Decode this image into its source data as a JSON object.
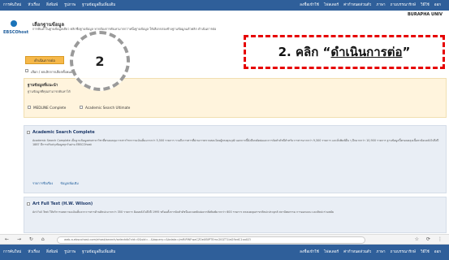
{
  "topbar": {
    "left": [
      "การค้นใหม่",
      "หัวเรื่อง",
      "สิ่งพิมพ์",
      "รูปภาพ",
      "ฐานข้อมูลอื่นเพิ่มเติม"
    ],
    "right": [
      "ลงชื่อเข้าใช้",
      "โฟลเดอร์",
      "ค่ากำหนดส่วนตัว",
      "ภาษา",
      "ถามบรรณารักษ์",
      "วิธีใช้",
      "ออก"
    ]
  },
  "brand": "BURAPHA UNIV",
  "logo_text": "EBSCOhost",
  "page": {
    "title": "เลือกฐานข้อมูล",
    "desc": "การค้นหาในฐานข้อมูลเดียว คลิกชื่อฐานข้อมูล หากต้องการค้นหามากกว่าหนึ่งฐานข้อมูล ให้เลือกกล่องข้างฐานข้อมูลแล้วคลิก ดำเนินการต่อ"
  },
  "continue_label": "ดำเนินการต่อ",
  "select_all_label": "เลือก / ยกเลิกการเลือกทั้งหมด",
  "suggest": {
    "title": "ฐานข้อมูลที่แนะนำ",
    "desc": "ฐานข้อมูลที่คุณสามารถค้นหาได้",
    "options": [
      "MEDLINE Complete",
      "Academic Search Ultimate"
    ]
  },
  "databases": [
    {
      "title": "Academic Search Complete",
      "desc": "Academic Search Complete เป็นฐานข้อมูลสหสาขาวิชาที่ครอบคลุมวารสารวิชาการฉบับเต็มมากกว่า 5,500 รายการ รวมถึงวารสารที่ผ่านการตรวจสอบโดยผู้ทรงคุณวุฒิ นอกจากนี้ยังมีบทคัดย่อและการจัดทำดัชนีสำหรับวารสารมากกว่า 9,300 รายการ และสิ่งพิมพ์อื่น ๆ อีกมากกว่า 10,900 รายการ ฐานข้อมูลนี้ครอบคลุมเนื้อหาย้อนหลังไปถึงปี 1887 มีการปรับปรุงข้อมูลทุกวันผ่าน EBSCOhost",
      "links": [
        "รายการชื่อเรื่อง",
        "ข้อมูลเพิ่มเติม"
      ]
    },
    {
      "title": "Art Full Text (H.W. Wilson)",
      "desc": "Art Full Text ให้บริการบทความฉบับเต็มจากวารสารด้านศิลปะมากกว่า 350 รายการ ย้อนหลังไปถึงปี 1995 พร้อมทั้งการจัดทำดัชนีและบทคัดย่อจากสิ่งพิมพ์มากกว่า 600 รายการ ครอบคลุมสาขาศิลปะประยุกต์ สถาปัตยกรรม การออกแบบ และศิลปะร่วมสมัย"
    }
  ],
  "browser": {
    "nav": [
      "←",
      "→",
      "↻",
      "⌂"
    ],
    "url": "web.a.ebscohost.com/ehost/search/selectdb?vid=0&sid=...&bquery=&bdata=JmRiPWFwaCZ0eXBlPTEmc2l0ZT1laG9zdC1saXZl",
    "icons": [
      "☆",
      "⟳",
      "⋮"
    ]
  },
  "annotations": {
    "step_number": "2",
    "callout_prefix": "2. คลิก “",
    "callout_action": "ดำเนินการต่อ",
    "callout_suffix": "”"
  }
}
